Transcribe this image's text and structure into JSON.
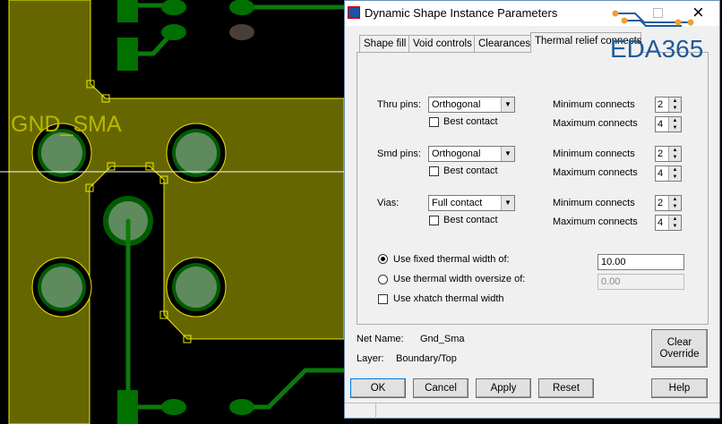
{
  "canvas": {
    "net_label": "GND_SMA"
  },
  "dialog": {
    "title": "Dynamic Shape Instance Parameters",
    "watermark": "EDA365",
    "tabs": [
      {
        "label": "Shape fill"
      },
      {
        "label": "Void controls"
      },
      {
        "label": "Clearances"
      },
      {
        "label": "Thermal relief connects",
        "active": true
      }
    ],
    "groups": [
      {
        "label": "Thru pins:",
        "type": "Orthogonal",
        "best_contact": "Best contact",
        "best_contact_checked": false,
        "min_label": "Minimum connects",
        "min": "2",
        "max_label": "Maximum connects",
        "max": "4"
      },
      {
        "label": "Smd pins:",
        "type": "Orthogonal",
        "best_contact": "Best contact",
        "best_contact_checked": false,
        "min_label": "Minimum connects",
        "min": "2",
        "max_label": "Maximum connects",
        "max": "4"
      },
      {
        "label": "Vias:",
        "type": "Full contact",
        "best_contact": "Best contact",
        "best_contact_checked": false,
        "min_label": "Minimum connects",
        "min": "2",
        "max_label": "Maximum connects",
        "max": "4"
      }
    ],
    "width_options": {
      "fixed": {
        "label": "Use fixed thermal width of:",
        "selected": true,
        "value": "10.00"
      },
      "oversize": {
        "label": "Use thermal width oversize of:",
        "selected": false,
        "value": "0.00"
      },
      "xhatch": {
        "label": "Use xhatch thermal width",
        "checked": false
      }
    },
    "net_name_label": "Net Name:",
    "net_name": "Gnd_Sma",
    "layer_label": "Layer:",
    "layer": "Boundary/Top",
    "buttons": {
      "clear_override_1": "Clear",
      "clear_override_2": "Override",
      "ok": "OK",
      "cancel": "Cancel",
      "apply": "Apply",
      "reset": "Reset",
      "help": "Help"
    },
    "close_icon": "×"
  }
}
